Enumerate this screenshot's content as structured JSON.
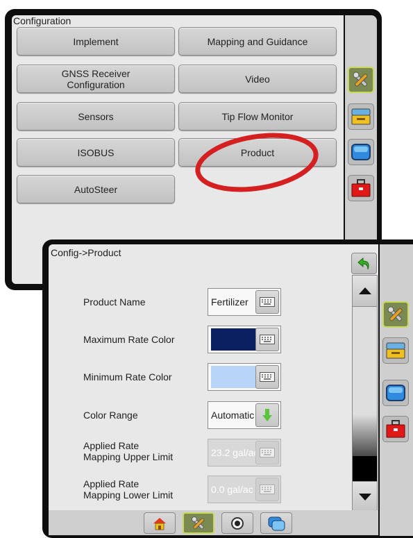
{
  "config_window": {
    "title": "Configuration",
    "buttons": [
      {
        "label": "Implement"
      },
      {
        "label": "Mapping and Guidance"
      },
      {
        "label": "GNSS Receiver\nConfiguration"
      },
      {
        "label": "Video"
      },
      {
        "label": "Sensors"
      },
      {
        "label": "Tip Flow Monitor"
      },
      {
        "label": "ISOBUS"
      },
      {
        "label": "Product"
      },
      {
        "label": "AutoSteer"
      }
    ],
    "sidebar_tabs": [
      "tools-icon",
      "console-icon",
      "screen-icon",
      "toolbox-icon"
    ],
    "active_tab": "tools-icon"
  },
  "product_window": {
    "title": "Config->Product",
    "rows": [
      {
        "label": "Product Name",
        "value": "Fertilizer",
        "enabled": true
      },
      {
        "label": "Maximum Rate Color",
        "color": "#0a2060",
        "enabled": true
      },
      {
        "label": "Minimum Rate Color",
        "color": "#b8d4f8",
        "enabled": true
      },
      {
        "label": "Color Range",
        "value": "Automatic",
        "enabled": true
      },
      {
        "label": "Applied Rate\nMapping Upper Limit",
        "value": "23.2 gal/ac",
        "enabled": false
      },
      {
        "label": "Applied Rate\nMapping Lower Limit",
        "value": "0.0 gal/ac",
        "enabled": false
      }
    ],
    "sidebar_tabs": [
      "tools-icon",
      "console-icon",
      "screen-icon",
      "toolbox-icon"
    ],
    "bottom_tabs": [
      "home-icon",
      "tools-icon",
      "camera-icon",
      "screens-icon"
    ],
    "active_bottom_tab": "tools-icon"
  },
  "colors": {
    "highlight_circle": "#d42020",
    "active_tab_border": "#c9d857",
    "active_tab_fill": "#7b8a50"
  }
}
